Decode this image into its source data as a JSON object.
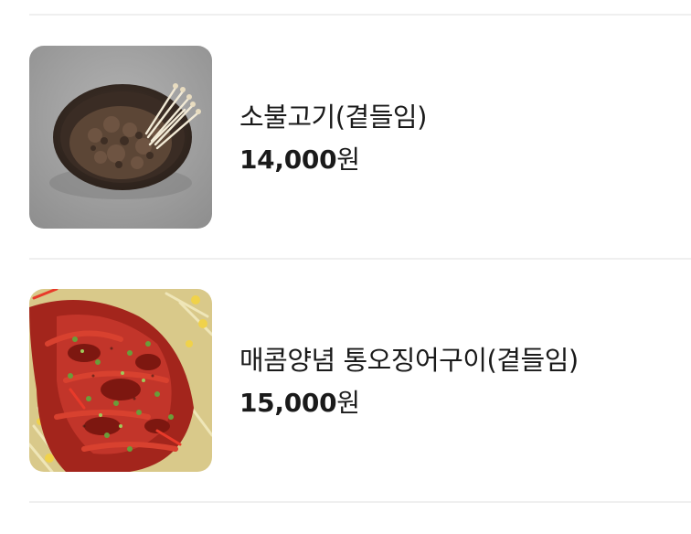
{
  "menu": {
    "items": [
      {
        "name": "소불고기(곁들임)",
        "price": "14,000",
        "currency": "원",
        "image_icon": "bulgogi-photo"
      },
      {
        "name": "매콤양념 통오징어구이(곁들임)",
        "price": "15,000",
        "currency": "원",
        "image_icon": "grilled-squid-photo"
      }
    ]
  }
}
